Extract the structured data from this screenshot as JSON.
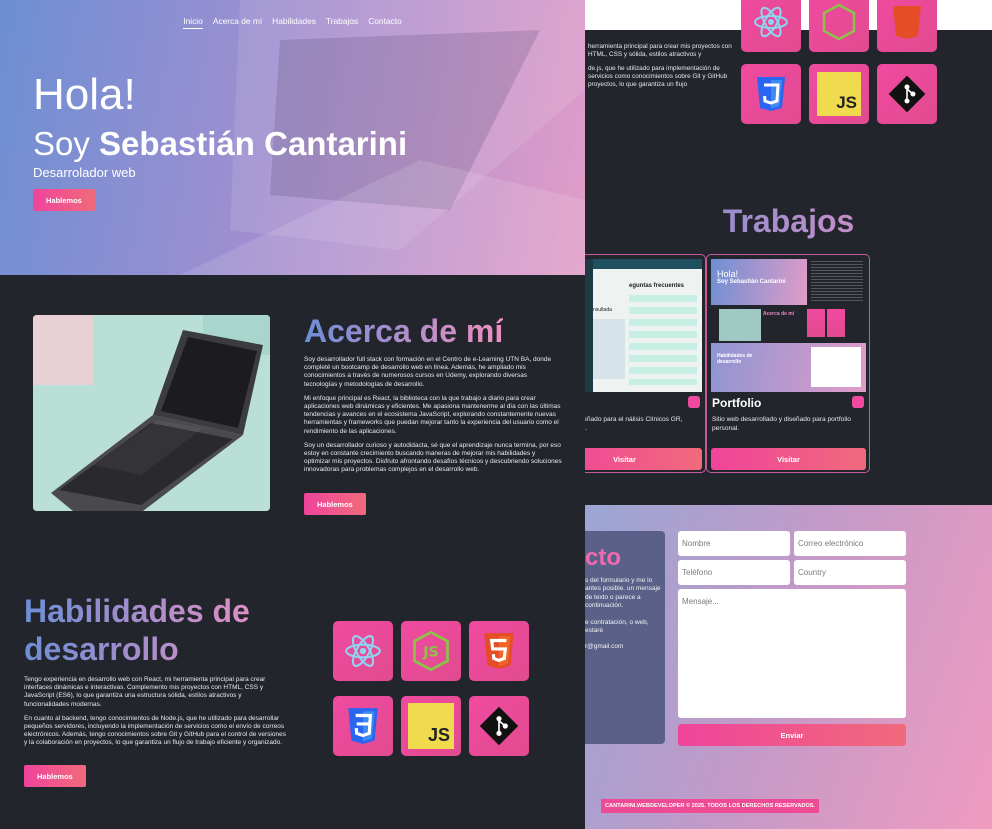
{
  "nav": {
    "items": [
      "Inicio",
      "Acerca de mí",
      "Habilidades",
      "Trabajos",
      "Contacto"
    ]
  },
  "hero": {
    "greeting": "Hola!",
    "intro_prefix": "Soy",
    "name": "Sebastián Cantarini",
    "role": "Desarrolador web",
    "cta": "Hablemos"
  },
  "about": {
    "title": "Acerca de mí",
    "paragraphs": [
      "Soy desarrollador full stack con formación en el Centro de e-Learning UTN BA, donde completé un bootcamp de desarrollo web en línea. Además, he ampliado mis conocimientos a través de numerosos cursos en Udemy, explorando diversas tecnologías y metodologías de desarrollo.",
      "Mi enfoque principal es React, la biblioteca con la que trabajo a diario para crear aplicaciones web dinámicas y eficientes. Me apasiona mantenerme al día con las últimas tendencias y avances en el ecosistema JavaScript, explorando constantemente nuevas herramientas y frameworks que puedan mejorar tanto la experiencia del usuario como el rendimiento de las aplicaciones.",
      "Soy un desarrollador curioso y autodidacta, sé que el aprendizaje nunca termina, por eso estoy en constante crecimiento buscando maneras de mejorar mis habilidades y optimizar mis proyectos. Disfruto afrontando desafíos técnicos y descubriendo soluciones innovadoras para problemas complejos en el desarrollo web."
    ],
    "cta": "Hablemos"
  },
  "skills": {
    "title": "Habilidades de desarrollo",
    "paragraphs": [
      "Tengo experiencia en desarrollo web con React, mi herramienta principal para crear interfaces dinámicas e interactivas. Complemento mis proyectos con HTML, CSS y JavaScript (ES6), lo que garantiza una estructura sólida, estilos atractivos y funcionalidades modernas.",
      "En cuanto al backend, tengo conocimientos de Node.js, que he utilizado para desarrollar pequeños servidores, incluyendo la implementación de servicios como el envío de correos electrónicos. Además, tengo conocimientos sobre Git y GitHub para el control de versiones y la colaboración en proyectos, lo que garantiza un flujo de trabajo eficiente y organizado."
    ],
    "cta": "Hablemos",
    "icons": [
      "react-icon",
      "nodejs-icon",
      "html5-icon",
      "css3-icon",
      "javascript-icon",
      "git-icon"
    ],
    "js_label": "JS"
  },
  "right_skills": {
    "paragraphs": [
      "herramienta principal para crear mis proyectos con HTML, CSS y sólida, estilos atractivos y",
      "de.js, que he utilizado para implementación de servicios como conocimientos sobre Git y GitHub proyectos, lo que garantiza un flujo"
    ]
  },
  "works": {
    "title": "Trabajos",
    "projects": [
      {
        "title": "",
        "description": "rollado y diseñado para el nálisis Clínicos GR, cliente de na.",
        "cta": "Visitar",
        "shot_heading": "eguntas frecuentes",
        "shot_side": "nsultada"
      },
      {
        "title": "Portfolio",
        "description": "Sitio web desarrollado y diseñado para portfolio personal.",
        "cta": "Visitar",
        "shot_hola": "Hola!",
        "shot_name": "Soy Sebastián Cantarini",
        "shot_about": "Acerca de mí",
        "shot_skills": "Habilidades de desarrollo"
      }
    ]
  },
  "contact": {
    "title": "cto",
    "paragraphs": [
      "s del formulario y me lo antes posible. un mensaje de texto o parece a continuación.",
      "e contratación, o web, estaré",
      "r@gmail.com"
    ],
    "placeholders": {
      "name": "Nombre",
      "email": "Correo electrónico",
      "phone": "Teléfono",
      "country": "Country",
      "message": "Mensaje..."
    },
    "send": "Enviar"
  },
  "footer": {
    "text": "CANTARINI.WEBDEVELOPER © 2025. TODOS LOS DERECHOS RESERVADOS."
  },
  "colors": {
    "accent": "#f0449b",
    "background": "#23252d",
    "gradient_start": "#6d8ed6",
    "gradient_end": "#ee8fc0"
  }
}
